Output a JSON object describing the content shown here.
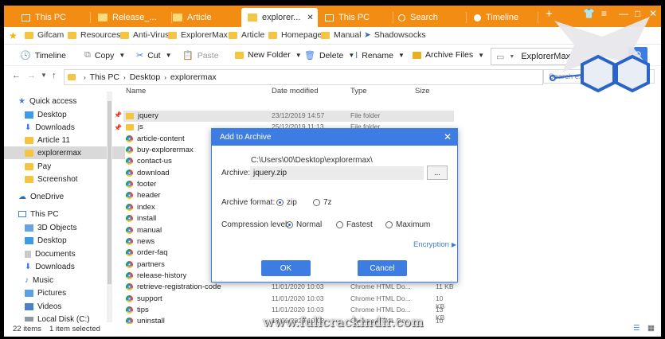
{
  "tabs": [
    {
      "label": "This PC",
      "icon": "monitor-icon"
    },
    {
      "label": "Release_...",
      "icon": "folder-icon"
    },
    {
      "label": "Article",
      "icon": "folder-icon"
    },
    {
      "label": "explorer...",
      "icon": "folder-icon",
      "active": true
    },
    {
      "label": "This PC",
      "icon": "monitor-icon"
    },
    {
      "label": "Search",
      "icon": "search-icon"
    },
    {
      "label": "Timeline",
      "icon": "timeline-icon"
    }
  ],
  "new_tab": "+",
  "bookmarks": [
    "Gifcam",
    "Resources",
    "Anti-Virus",
    "ExplorerMax",
    "Article",
    "Homepage",
    "Manual",
    "Shadowsocks"
  ],
  "toolbar": {
    "timeline": "Timeline",
    "copy": "Copy",
    "cut": "Cut",
    "paste": "Paste",
    "new_folder": "New Folder",
    "delete": "Delete",
    "rename": "Rename",
    "archive_files": "Archive Files",
    "search_value": "ExplorerMax"
  },
  "address": {
    "crumbs": [
      "This PC",
      "Desktop",
      "explorermax"
    ],
    "search_placeholder": "Search explorermax"
  },
  "nav": {
    "quick_access": "Quick access",
    "quick": [
      "Desktop",
      "Downloads",
      "Article 11",
      "explorermax",
      "Pay",
      "Screenshot"
    ],
    "onedrive": "OneDrive",
    "this_pc": "This PC",
    "pc": [
      "3D Objects",
      "Desktop",
      "Documents",
      "Downloads",
      "Music",
      "Pictures",
      "Videos",
      "Local Disk (C:)"
    ]
  },
  "columns": {
    "name": "Name",
    "date": "Date modified",
    "type": "Type",
    "size": "Size"
  },
  "files": [
    {
      "name": "jquery",
      "date": "23/12/2019 14:57",
      "type": "File folder",
      "size": "",
      "kind": "folder",
      "selected": true
    },
    {
      "name": "js",
      "date": "25/12/2019 11:13",
      "type": "File folder",
      "size": "",
      "kind": "folder"
    },
    {
      "name": "article-content",
      "date": "",
      "type": "",
      "size": "",
      "kind": "chrome"
    },
    {
      "name": "buy-explorermax",
      "date": "",
      "type": "",
      "size": "",
      "kind": "chrome"
    },
    {
      "name": "contact-us",
      "date": "",
      "type": "",
      "size": "",
      "kind": "chrome"
    },
    {
      "name": "download",
      "date": "",
      "type": "",
      "size": "",
      "kind": "chrome"
    },
    {
      "name": "footer",
      "date": "",
      "type": "",
      "size": "",
      "kind": "chrome"
    },
    {
      "name": "header",
      "date": "",
      "type": "",
      "size": "",
      "kind": "chrome"
    },
    {
      "name": "index",
      "date": "",
      "type": "",
      "size": "",
      "kind": "chrome"
    },
    {
      "name": "install",
      "date": "",
      "type": "",
      "size": "",
      "kind": "chrome"
    },
    {
      "name": "manual",
      "date": "",
      "type": "",
      "size": "",
      "kind": "chrome"
    },
    {
      "name": "news",
      "date": "",
      "type": "",
      "size": "",
      "kind": "chrome"
    },
    {
      "name": "order-faq",
      "date": "",
      "type": "",
      "size": "",
      "kind": "chrome"
    },
    {
      "name": "partners",
      "date": "",
      "type": "",
      "size": "",
      "kind": "chrome"
    },
    {
      "name": "release-history",
      "date": "",
      "type": "",
      "size": "",
      "kind": "chrome"
    },
    {
      "name": "retrieve-registration-code",
      "date": "11/01/2020 10:03",
      "type": "Chrome HTML Do...",
      "size": "11 KB",
      "kind": "chrome"
    },
    {
      "name": "support",
      "date": "11/01/2020 10:03",
      "type": "Chrome HTML Do...",
      "size": "10 KB",
      "kind": "chrome"
    },
    {
      "name": "tips",
      "date": "11/01/2020 10:03",
      "type": "Chrome HTML Do...",
      "size": "13 KB",
      "kind": "chrome"
    },
    {
      "name": "uninstall",
      "date": "13/01/2020 10:03",
      "type": "Chrome HTML Do...",
      "size": "10 KB",
      "kind": "chrome"
    }
  ],
  "status": {
    "count": "22 items",
    "selected": "1 item selected"
  },
  "dialog": {
    "title": "Add to Archive",
    "path": "C:\\Users\\00\\Desktop\\explorermax\\",
    "archive_label": "Archive:",
    "archive_value": "jquery.zip",
    "browse": "...",
    "format_label": "Archive format:",
    "format_options": [
      "zip",
      "7z"
    ],
    "level_label": "Compression level:",
    "level_options": [
      "Normal",
      "Fastest",
      "Maximum"
    ],
    "encryption": "Encryption",
    "ok": "OK",
    "cancel": "Cancel"
  },
  "watermark": "www.fullcrackindir.com",
  "colors": {
    "tabbar": "#f28c13",
    "accent": "#3d7de3",
    "folder": "#f5c542"
  }
}
